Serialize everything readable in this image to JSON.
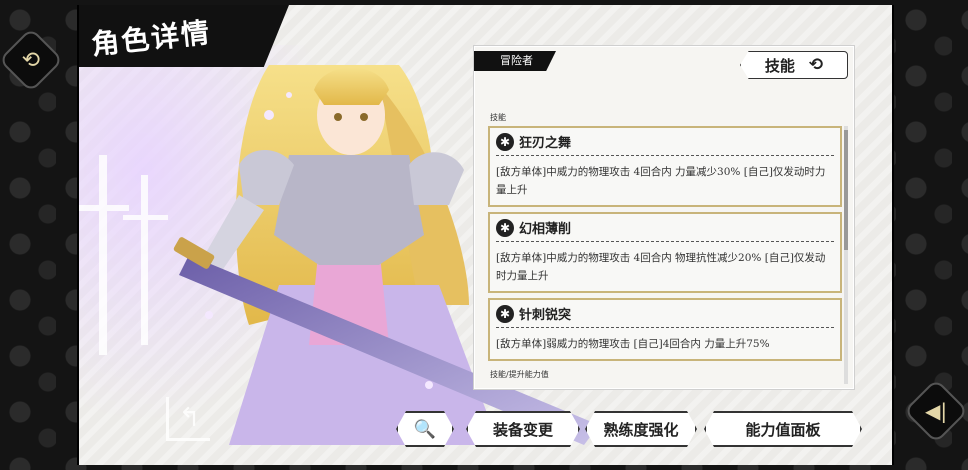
{
  "header": {
    "title": "角色详情"
  },
  "card": {
    "tag": "冒险者",
    "toggle_label": "技能",
    "section_skills": "技能",
    "section_next": "技能/提升能力值",
    "skills": [
      {
        "name": "狂刃之舞",
        "desc": "[敌方单体]中威力的物理攻击 4回合内 力量减少30% [自己]仅发动时力量上升",
        "icon": "gear-icon"
      },
      {
        "name": "幻相薄削",
        "desc": "[敌方单体]中威力的物理攻击 4回合内 物理抗性减少20% [自己]仅发动时力量上升",
        "icon": "gear-icon"
      },
      {
        "name": "针刺锐突",
        "desc": "[敌方单体]弱威力的物理攻击 [自己]4回合内 力量上升75%",
        "icon": "gear-icon"
      }
    ]
  },
  "buttons": {
    "search": "🔍",
    "equip": "装备变更",
    "mastery": "熟练度强化",
    "stats": "能力值面板"
  },
  "colors": {
    "accent": "#c8b47a",
    "panel": "#ecebe8",
    "dark": "#111111"
  }
}
